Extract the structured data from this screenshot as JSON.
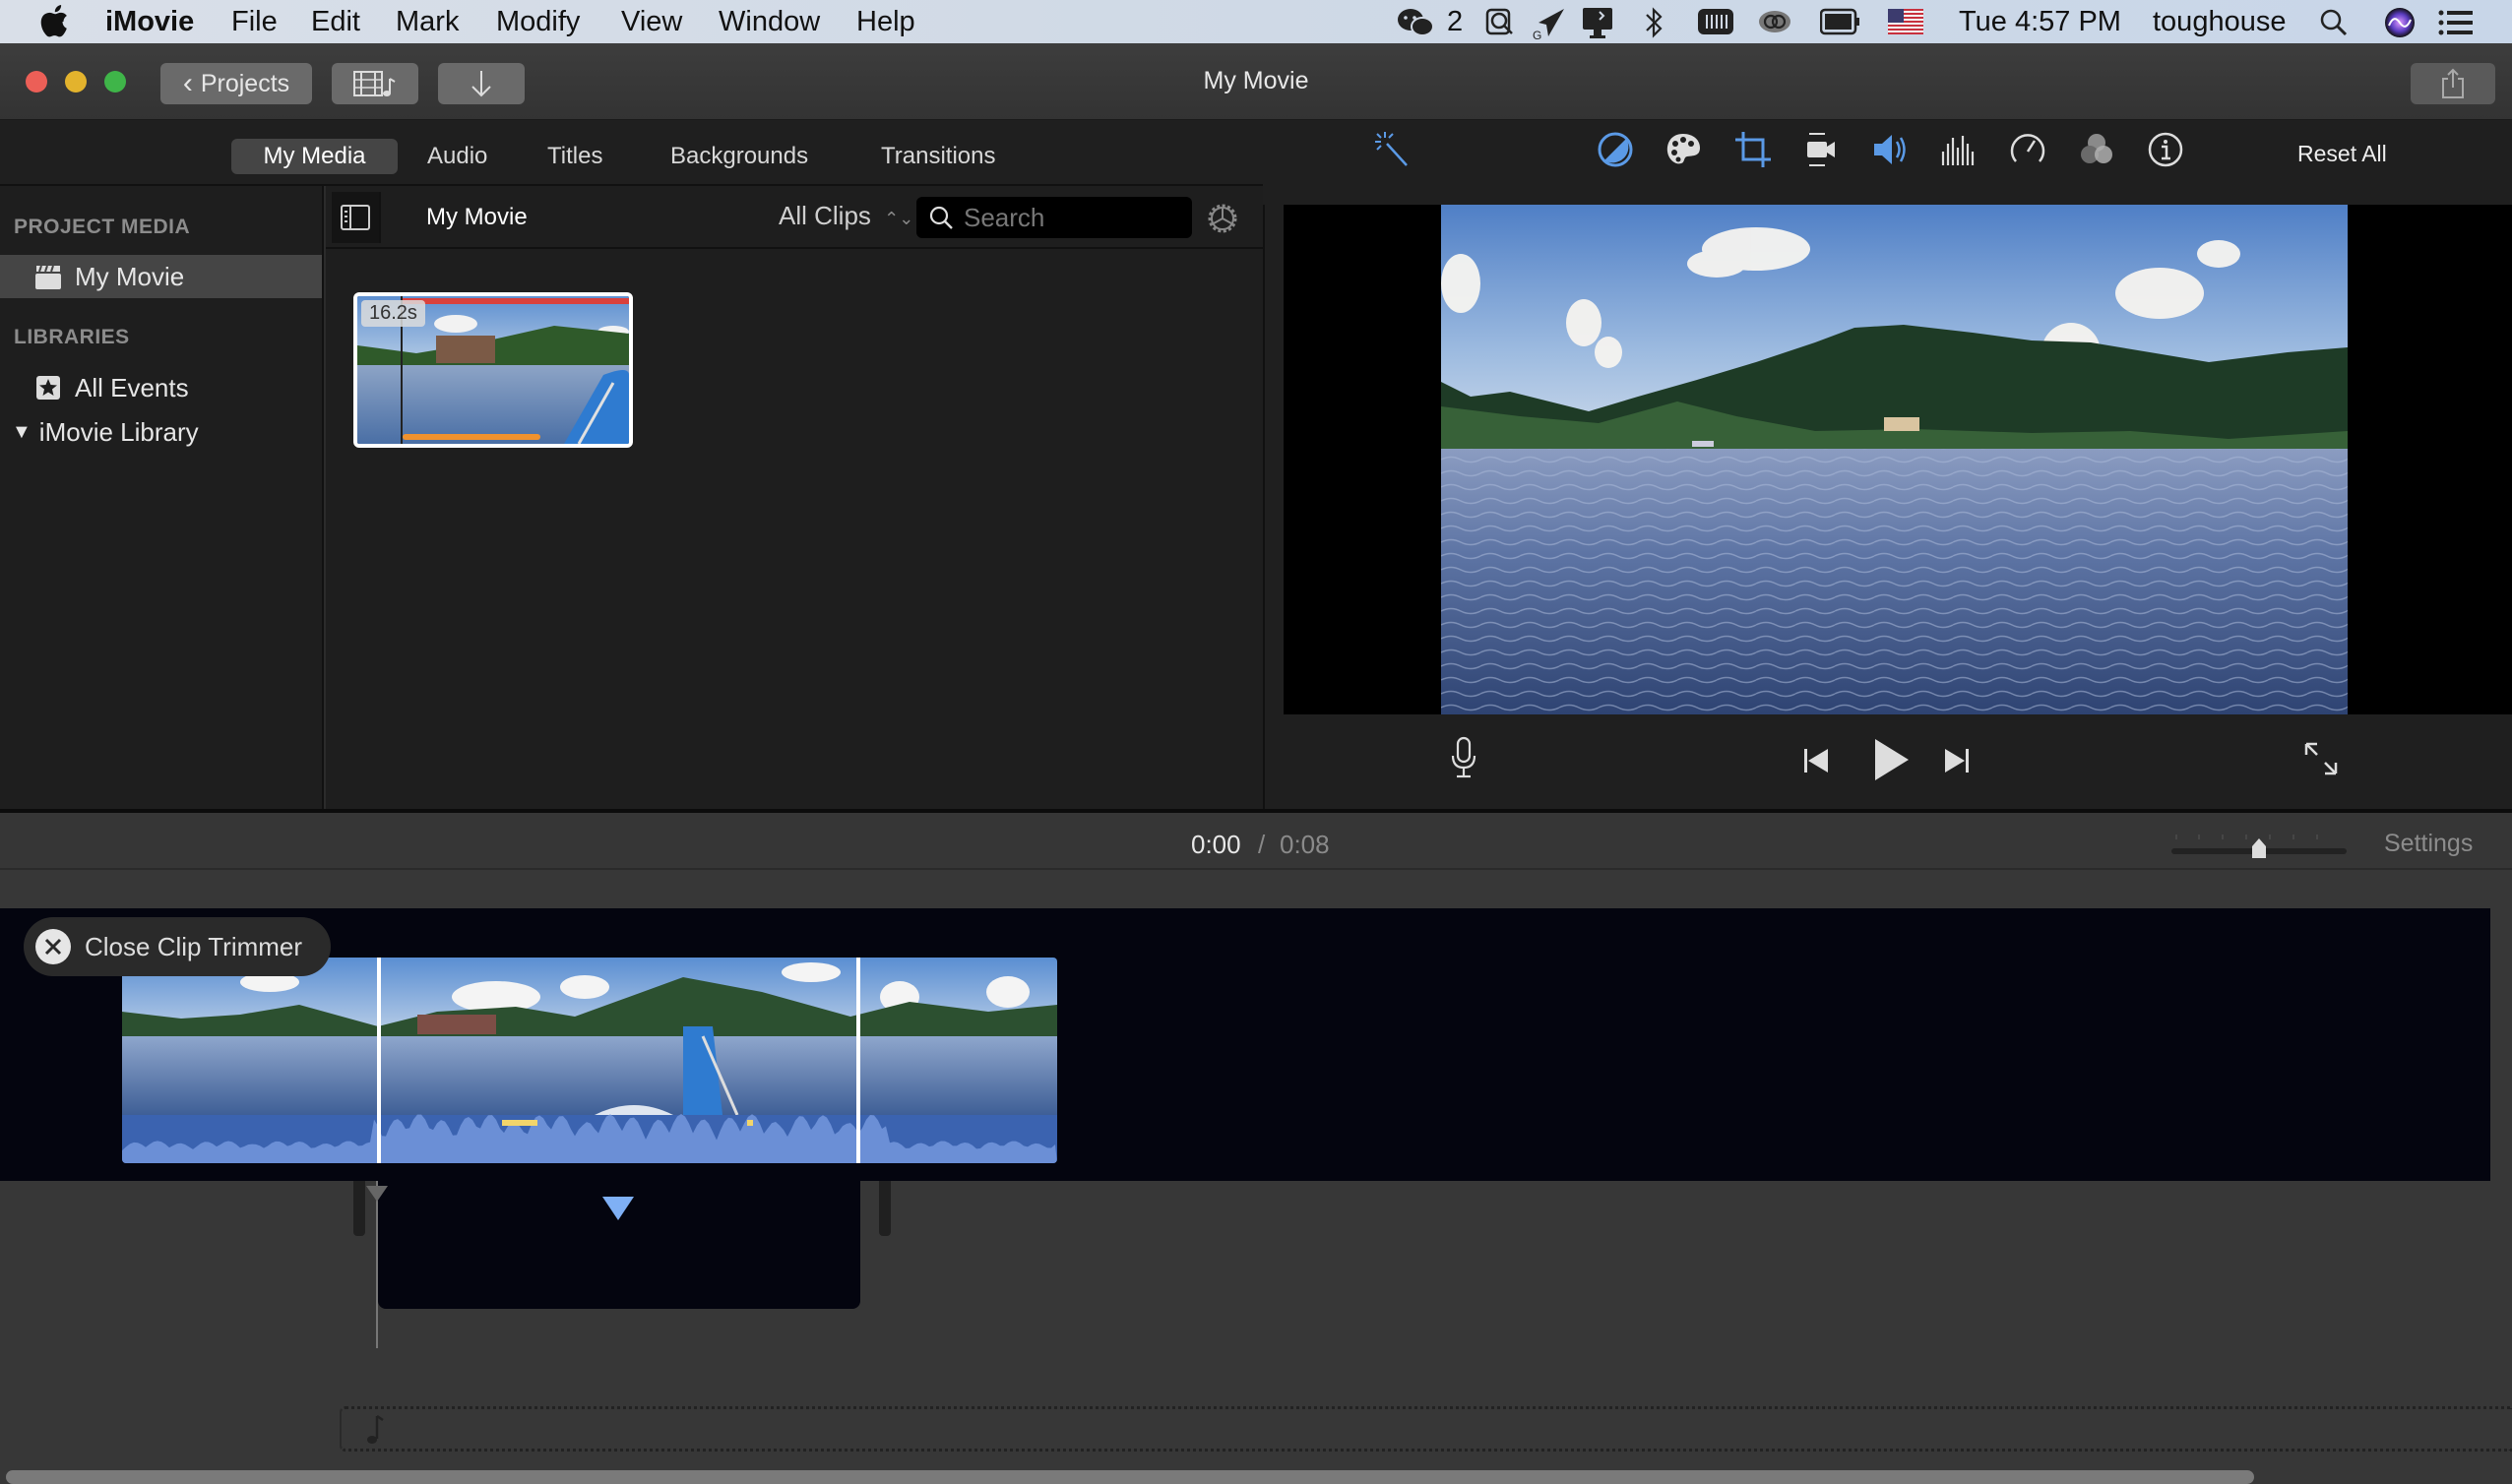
{
  "menubar": {
    "app_name": "iMovie",
    "items": [
      "File",
      "Edit",
      "Mark",
      "Modify",
      "View",
      "Window",
      "Help"
    ],
    "status": {
      "wechat_count": "2",
      "clock": "Tue 4:57 PM",
      "user": "toughouse"
    },
    "status_icons": [
      "wechat-icon",
      "screenshot-icon",
      "send-icon",
      "airplay-display-icon",
      "bluetooth-icon",
      "memory-icon",
      "creative-cloud-icon",
      "battery-icon",
      "us-flag-icon",
      "spotlight-icon",
      "siri-icon",
      "notification-center-icon"
    ]
  },
  "titlebar": {
    "title": "My Movie",
    "projects_label": "Projects"
  },
  "browser_tabs": [
    {
      "label": "My Media",
      "active": true
    },
    {
      "label": "Audio",
      "active": false
    },
    {
      "label": "Titles",
      "active": false
    },
    {
      "label": "Backgrounds",
      "active": false
    },
    {
      "label": "Transitions",
      "active": false
    }
  ],
  "inspector": {
    "tools": [
      "magic-wand-icon",
      "color-balance-icon",
      "color-correction-icon",
      "crop-icon",
      "stabilization-icon",
      "volume-icon",
      "noise-reduction-equalizer-icon",
      "speed-icon",
      "clip-filter-icon",
      "clip-info-icon"
    ],
    "reset_label": "Reset All"
  },
  "sidebar": {
    "project_media_heading": "PROJECT MEDIA",
    "project_item": "My Movie",
    "libraries_heading": "LIBRARIES",
    "all_events": "All Events",
    "library": "iMovie Library"
  },
  "browser": {
    "title": "My Movie",
    "filter": "All Clips",
    "search_placeholder": "Search",
    "search_value": "",
    "clips": [
      {
        "duration": "16.2s"
      }
    ]
  },
  "playback": {
    "current_time": "0:00",
    "separator": "/",
    "total_time": "0:08"
  },
  "timeline": {
    "settings_label": "Settings",
    "close_trimmer_label": "Close Clip Trimmer",
    "zoom_level": 0.5,
    "scroll_fraction": 0.9
  },
  "colors": {
    "accent_blue": "#4a90e2",
    "selected_range_red": "#d9413d",
    "used_range_orange": "#f0922e",
    "audio_waveform": "#3b63b0"
  }
}
